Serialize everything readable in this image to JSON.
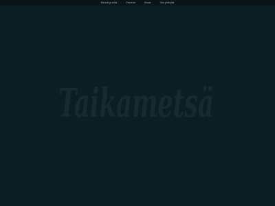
{
  "nav": {
    "items": [
      {
        "label": "Meistä ja mitä"
      },
      {
        "label": "Palvelut"
      },
      {
        "label": "Kuvat"
      },
      {
        "label": "Ota yhteyttä"
      }
    ]
  },
  "hero": {
    "logo_text": "Taikametsä",
    "logo_color": "#172a31"
  },
  "colors": {
    "background": "#0c1d24",
    "nav_background": "#0a1519",
    "nav_text": "#a9b8bd"
  }
}
